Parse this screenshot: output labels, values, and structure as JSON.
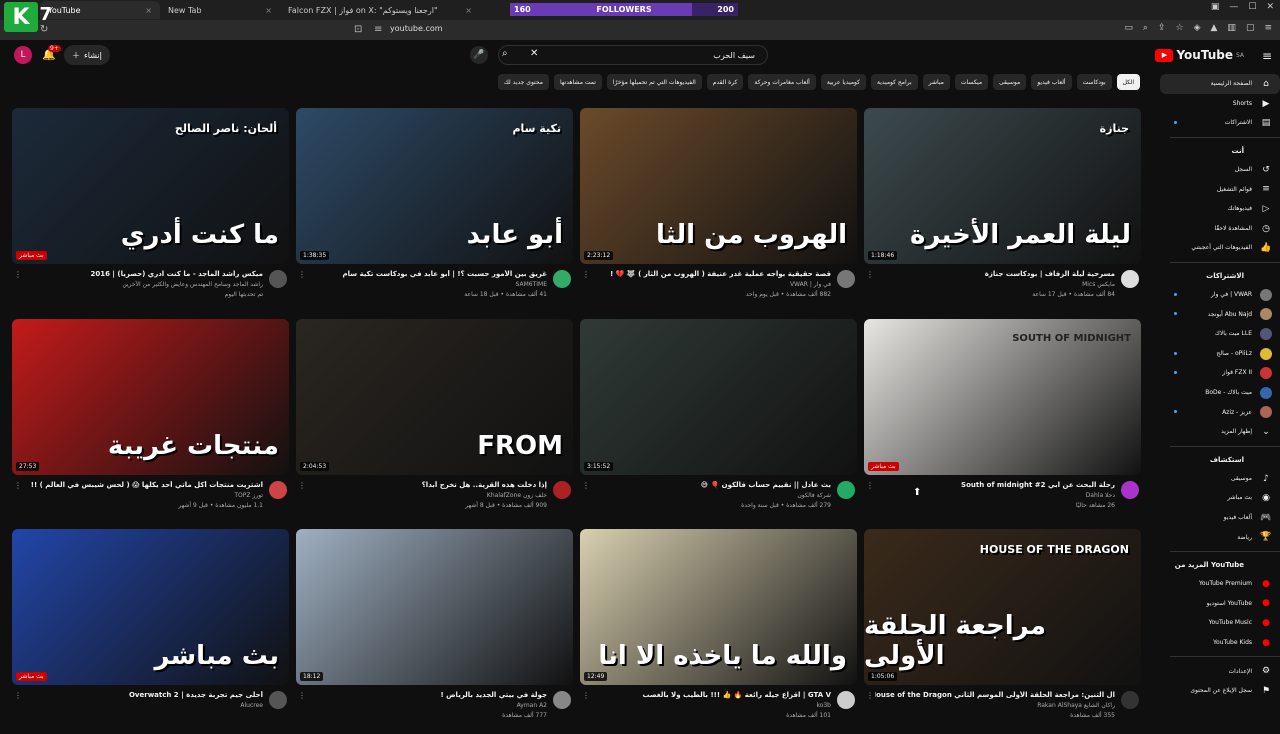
{
  "browser": {
    "tabs": [
      {
        "label": "YouTube",
        "active": true
      },
      {
        "label": "New Tab",
        "active": false
      },
      {
        "label": "Falcon FZX | فواز on X: \"ارجعنا ويستوكم\"",
        "active": false
      }
    ],
    "url": "youtube.com",
    "overlay_logo": "K",
    "overlay_number": "7",
    "followers": {
      "label": "FOLLOWERS",
      "current": "160",
      "goal": "200",
      "progress": 0.8
    }
  },
  "header": {
    "logo": "YouTube",
    "logo_region": "SA",
    "search_value": "سيف الحرب",
    "create_label": "إنشاء",
    "notification_count": "9+",
    "avatar_letter": "L"
  },
  "chips": [
    {
      "label": "الكل",
      "active": true
    },
    {
      "label": "بودكاست",
      "active": false
    },
    {
      "label": "ألعاب فيديو",
      "active": false
    },
    {
      "label": "موسيقى",
      "active": false
    },
    {
      "label": "ميكسات",
      "active": false
    },
    {
      "label": "مباشر",
      "active": false
    },
    {
      "label": "برامج كوميدية",
      "active": false
    },
    {
      "label": "كوميديا عربية",
      "active": false
    },
    {
      "label": "ألعاب مغامرات وحركة",
      "active": false
    },
    {
      "label": "كرة القدم",
      "active": false
    },
    {
      "label": "الفيديوهات التي تم تحميلها مؤخرًا",
      "active": false
    },
    {
      "label": "تمت مشاهدتها",
      "active": false
    },
    {
      "label": "محتوى جديد لك",
      "active": false
    }
  ],
  "videos": [
    {
      "thumb_title": "ما كنت أدري",
      "thumb_sub": "ألحان: ناصر الصالح",
      "duration": "",
      "badge": "بث مباشر",
      "title": "ميكس راشد الماجد - ما كنت ادري (حصريا) | 2016",
      "channel": "راشد الماجد وسامح المهندس وعايض والكثير من الآخرين",
      "stats": "تم تحديثها اليوم",
      "bg": "#1b2a3a",
      "av": "#555"
    },
    {
      "thumb_title": "أبو عابد",
      "thumb_sub": "تكية سام",
      "duration": "1:38:35",
      "badge": "",
      "title": "غريق بين الأمور حسبت ؟! | أبو عابد في بودكاست تكية سام",
      "channel": "SAM6TIME",
      "stats": "41 ألف مشاهدة • قبل 18 ساعة",
      "bg": "#2d4a66",
      "av": "#3a6"
    },
    {
      "thumb_title": "الهروب من الثا",
      "thumb_sub": "",
      "duration": "2:23:12",
      "badge": "",
      "title": "قصة حقيقية بواجه عملية غدر عنيفة ( الهروب من الثار ) 🐺 💔 !",
      "channel": "في وار | VWAR",
      "stats": "882 ألف مشاهدة • قبل يوم واحد",
      "bg": "#6b4a2a",
      "av": "#777"
    },
    {
      "thumb_title": "ليلة العمر الأخيرة",
      "thumb_sub": "جنازة",
      "duration": "1:18:46",
      "badge": "",
      "title": "مسرحية ليلة الزفاف | بودكاست جنازة",
      "channel": "مايكس Mics",
      "stats": "84 ألف مشاهدة • قبل 17 ساعة",
      "bg": "#3c4a4e",
      "av": "#ddd"
    },
    {
      "thumb_title": "منتجات غريبة",
      "thumb_sub": "",
      "duration": "27:53",
      "badge": "",
      "title": "اشتريت منتجات أكل ماتي أحد يكلها 😱 ( لحس شيبس في العالم ) !!",
      "channel": "تورز TOPZ",
      "stats": "1.1 مليون مشاهدة • قبل 9 أشهر",
      "bg": "#c41a1a",
      "av": "#c44"
    },
    {
      "thumb_title": "FROM",
      "thumb_sub": "",
      "duration": "2:04:53",
      "badge": "",
      "title": "إذا دخلت هذه القرية.. هل تخرج أبدا؟",
      "channel": "خلف زون KhalafZone",
      "stats": "909 ألف مشاهدة • قبل 8 أشهر",
      "bg": "#2a2620",
      "av": "#a22"
    },
    {
      "thumb_title": "",
      "thumb_sub": "",
      "duration": "3:15:52",
      "badge": "",
      "title": "بث عادل || نقييم حساب فالكون 🎈 😅",
      "channel": "شركة فالكون",
      "stats": "279 ألف مشاهدة • قبل سنة واحدة",
      "bg": "#2f3a36",
      "av": "#2a6"
    },
    {
      "thumb_title": "SOUTH OF MIDNIGHT",
      "thumb_sub": "",
      "duration": "",
      "badge": "بث مباشر",
      "title": "رحلة البحث عن ابي South of midnight #2",
      "channel": "دحلا Dahla",
      "stats": "26 مشاهد حاليًا",
      "bg": "#e8e6e2",
      "av": "#a3c"
    },
    {
      "thumb_title": "بث مباشر",
      "thumb_sub": "",
      "duration": "",
      "badge": "بث مباشر",
      "title": "أحلى جيم تجربة جديدة | Overwatch 2",
      "channel": "Alucree",
      "stats": "",
      "bg": "#2246a8",
      "av": "#555"
    },
    {
      "thumb_title": "",
      "thumb_sub": "",
      "duration": "18:12",
      "badge": "",
      "title": "جولة في بيتي الجديد بالرياض !",
      "channel": "Ayman A2",
      "stats": "777 ألف مشاهدة",
      "bg": "#9fb0c2",
      "av": "#888"
    },
    {
      "thumb_title": "والله ما ياخذه الا انا",
      "thumb_sub": "",
      "duration": "12:49",
      "badge": "",
      "title": "GTA V | اقزاع جيله رائعة 🔥 👍 !!! بالطيب ولا بالغصب",
      "channel": "ko3b",
      "stats": "101 ألف مشاهدة",
      "bg": "#d9d0b0",
      "av": "#ccc"
    },
    {
      "thumb_title": "مراجعة الحلقة الأولى",
      "thumb_sub": "HOUSE OF THE DRAGON",
      "duration": "1:05:06",
      "badge": "",
      "title": "آل التنين: مراجعة الحلقة الأولى الموسم الثاني House of the Dragon",
      "channel": "راكان الشايع Rakan AlShaya",
      "stats": "355 ألف مشاهدة",
      "bg": "#3a2a1a",
      "av": "#333"
    }
  ],
  "sidebar": {
    "main": [
      {
        "label": "الصفحة الرئيسية",
        "icon": "home-icon",
        "glyph": "⌂",
        "active": true
      },
      {
        "label": "Shorts",
        "icon": "shorts-icon",
        "glyph": "▶",
        "active": false
      },
      {
        "label": "الاشتراكات",
        "icon": "subscriptions-icon",
        "glyph": "▤",
        "active": false,
        "dot": true
      }
    ],
    "you_head": "أنت",
    "you": [
      {
        "label": "السجل",
        "icon": "history-icon",
        "glyph": "↺"
      },
      {
        "label": "قوائم التشغيل",
        "icon": "playlists-icon",
        "glyph": "≡"
      },
      {
        "label": "فيديوهاتك",
        "icon": "your-videos-icon",
        "glyph": "▷"
      },
      {
        "label": "المشاهدة لاحقًا",
        "icon": "watch-later-icon",
        "glyph": "◷"
      },
      {
        "label": "الفيديوهات التي أعجبتني",
        "icon": "liked-icon",
        "glyph": "👍"
      }
    ],
    "subs_head": "الاشتراكات",
    "subs": [
      {
        "label": "في وار | VWAR",
        "color": "#777",
        "dot": true
      },
      {
        "label": "أبونجد Abu Najd",
        "color": "#a86",
        "dot": true
      },
      {
        "label": "ميت بالاك LLE",
        "color": "#557",
        "dot": false
      },
      {
        "label": "صالح - oPiiLz",
        "color": "#db3",
        "dot": true
      },
      {
        "label": "فواز FZX II",
        "color": "#c33",
        "dot": true
      },
      {
        "label": "BoDe - ميت بالاك",
        "color": "#36a",
        "dot": false
      },
      {
        "label": "Aziz - عزيز",
        "color": "#a65",
        "dot": true
      },
      {
        "label": "إظهار المزيد",
        "color": "",
        "dot": false,
        "glyph": "⌄"
      }
    ],
    "explore_head": "استكشاف",
    "explore": [
      {
        "label": "موسيقى",
        "glyph": "♪",
        "icon": "music-icon"
      },
      {
        "label": "بث مباشر",
        "glyph": "◉",
        "icon": "live-icon"
      },
      {
        "label": "ألعاب فيديو",
        "glyph": "🎮",
        "icon": "gaming-icon"
      },
      {
        "label": "رياضة",
        "glyph": "🏆",
        "icon": "sports-icon"
      }
    ],
    "more_head": "المزيد من YouTube",
    "more": [
      {
        "label": "YouTube Premium",
        "icon": "yt-premium-icon"
      },
      {
        "label": "استوديو YouTube",
        "icon": "yt-studio-icon"
      },
      {
        "label": "YouTube Music",
        "icon": "yt-music-icon"
      },
      {
        "label": "YouTube Kids",
        "icon": "yt-kids-icon"
      }
    ],
    "footer": [
      {
        "label": "الإعدادات",
        "glyph": "⚙",
        "icon": "settings-icon"
      },
      {
        "label": "سجل الإبلاغ عن المحتوى",
        "glyph": "⚑",
        "icon": "report-history-icon"
      }
    ]
  }
}
